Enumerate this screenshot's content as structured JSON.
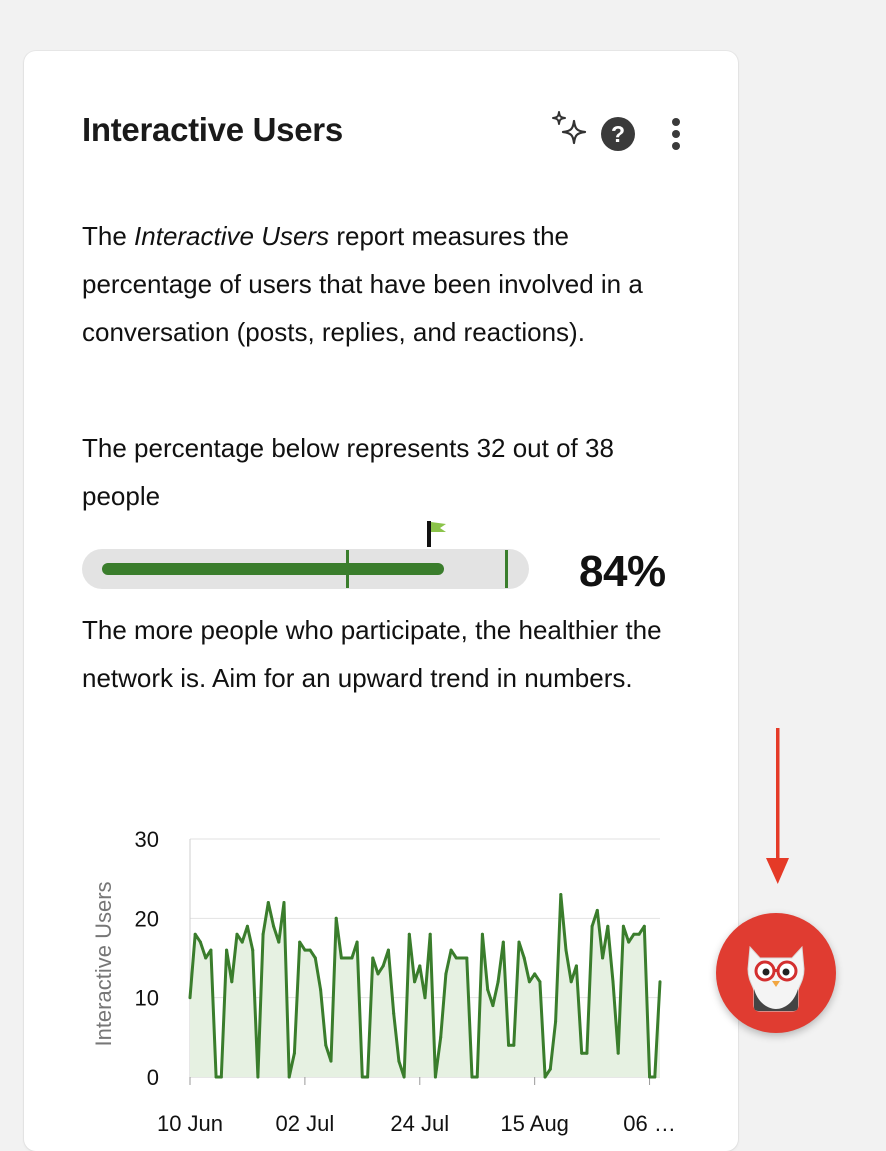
{
  "card": {
    "title": "Interactive Users",
    "icons": [
      "ai-sparkle-icon",
      "help-icon",
      "more-vertical-icon"
    ]
  },
  "description": {
    "before": "The ",
    "italic": "Interactive Users",
    "after": " report measures the percentage of users that have been involved in a conversation (posts, replies, and reactions)."
  },
  "summary_text": "The percentage below represents 32 out of 38 people",
  "progress": {
    "value": 0.84,
    "label": "84%",
    "fill_color": "#3a7d2c",
    "track_color": "#e3e3e3",
    "flag_color": "#8bc34a"
  },
  "advice_text": "The more people who participate, the healthier the network is. Aim for an upward trend in numbers.",
  "chart_data": {
    "type": "area",
    "ylabel": "Interactive Users",
    "ylim": [
      0,
      30
    ],
    "yticks": [
      0,
      10,
      20,
      30
    ],
    "xtick_labels": [
      "10 Jun",
      "02 Jul",
      "24 Jul",
      "15 Aug",
      "06 …"
    ],
    "xtick_days": [
      0,
      22,
      44,
      66,
      88
    ],
    "color": "#3a7d2c",
    "fill": "#e6f1e2",
    "grid": true,
    "values": [
      10,
      18,
      17,
      15,
      16,
      0,
      0,
      16,
      12,
      18,
      17,
      19,
      16,
      0,
      18,
      22,
      19,
      17,
      22,
      0,
      3,
      17,
      16,
      16,
      15,
      11,
      4,
      2,
      20,
      15,
      15,
      15,
      17,
      0,
      0,
      15,
      13,
      14,
      16,
      8,
      2,
      0,
      18,
      12,
      14,
      10,
      18,
      0,
      5,
      13,
      16,
      15,
      15,
      15,
      0,
      0,
      18,
      11,
      9,
      12,
      17,
      4,
      4,
      17,
      15,
      12,
      13,
      12,
      0,
      1,
      7,
      23,
      16,
      12,
      14,
      3,
      3,
      19,
      21,
      15,
      19,
      12,
      3,
      19,
      17,
      18,
      18,
      19,
      0,
      0,
      12
    ]
  },
  "fab": {
    "icon": "owl-mascot-icon"
  },
  "annotation": {
    "icon": "arrow-down-icon",
    "color": "#e53a27"
  }
}
